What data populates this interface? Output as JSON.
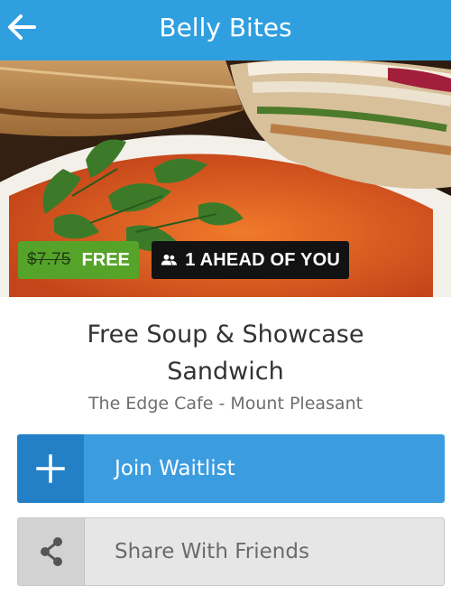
{
  "app_bar": {
    "title": "Belly Bites",
    "back_icon": "arrow-left-icon",
    "color": "#2f9fe0"
  },
  "hero": {
    "image": "soup-and-sandwich-photo",
    "original_price": "$7.75",
    "discount_label": "FREE",
    "queue_icon": "people-icon",
    "queue_text": "1 AHEAD OF YOU"
  },
  "deal": {
    "title": "Free Soup & Showcase Sandwich",
    "location": "The Edge Cafe - Mount Pleasant"
  },
  "actions": {
    "join": {
      "label": "Join Waitlist",
      "icon": "plus-icon",
      "color": "#3b9de0"
    },
    "share": {
      "label": "Share With Friends",
      "icon": "share-icon"
    }
  },
  "colors": {
    "free_badge": "#56a32a",
    "queue_badge": "#121212"
  }
}
